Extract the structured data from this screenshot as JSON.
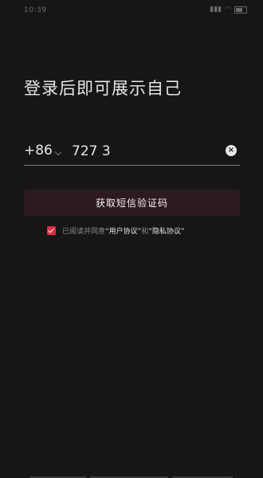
{
  "status_bar": {
    "time": "10:39",
    "icons": [
      "signal-icon",
      "wifi-icon",
      "battery-icon"
    ]
  },
  "login": {
    "title": "登录后即可展示自己",
    "country_code": "+86",
    "phone_value": "727 3",
    "clear_icon": "clear-icon",
    "submit_label": "获取短信验证码"
  },
  "agreement": {
    "checked": true,
    "prefix": "已阅读并同意",
    "user_agreement": "“用户协议”",
    "and": "和",
    "privacy_policy": "“隐私协议”"
  },
  "colors": {
    "background": "#161616",
    "accent": "#e02c45",
    "button_bg": "#2c1a1f"
  }
}
